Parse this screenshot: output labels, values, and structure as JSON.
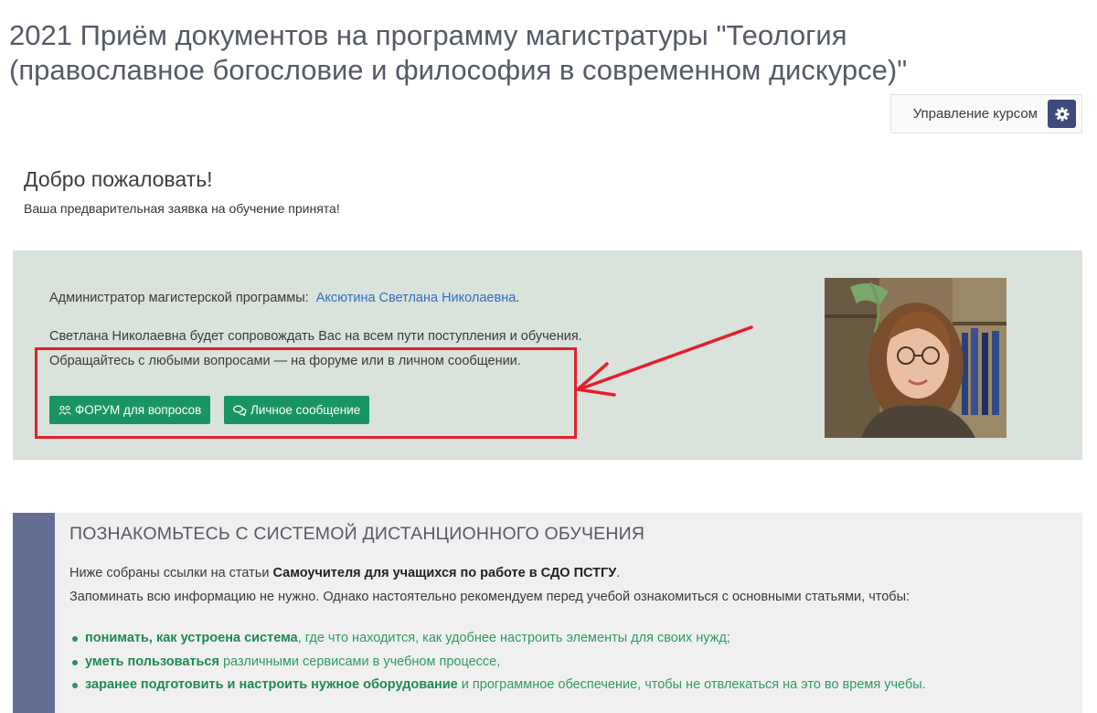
{
  "page": {
    "title": "2021 Приём документов на программу магистратуры \"Теология (православное богословие и философия в современном дискурсе)\""
  },
  "course_admin": {
    "label": "Управление курсом",
    "icon": "gear-icon"
  },
  "welcome": {
    "title": "Добро пожаловать!",
    "text": "Ваша предварительная заявка на обучение принята!"
  },
  "admin_panel": {
    "admin_prefix": "Администратор магистерской программы:",
    "admin_name": "Аксютина Светлана Николаевна",
    "admin_suffix": ".",
    "line2": "Светлана Николаевна будет сопровождать Вас на всем пути поступления и обучения.",
    "line3": "Обращайтесь с любыми вопросами — на форуме или в личном сообщении.",
    "forum_button": "ФОРУМ для вопросов",
    "message_button": "Личное сообщение"
  },
  "info_panel": {
    "title": "ПОЗНАКОМЬТЕСЬ С СИСТЕМОЙ ДИСТАНЦИОННОГО ОБУЧЕНИЯ",
    "line1_prefix": "Ниже собраны ссылки на статьи",
    "line1_bold": "Самоучителя для учащихся по работе в СДО ПСТГУ",
    "line1_suffix": ".",
    "line2": "Запоминать всю информацию не нужно. Однако настоятельно рекомендуем перед учебой ознакомиться с основными статьями, чтобы:",
    "bullets": [
      {
        "bold": "понимать, как устроена система",
        "rest": ", где что находится, как удобнее настроить элементы для своих нужд;"
      },
      {
        "bold": "уметь пользоваться",
        "rest": " различными сервисами в учебном процессе,"
      },
      {
        "bold": "заранее подготовить и настроить нужное оборудование",
        "rest": " и программное обеспечение, чтобы не отвлекаться на это во время учебы."
      }
    ]
  },
  "colors": {
    "accent_green": "#1b9463",
    "highlight_red": "#e3202a",
    "sidebar_bar": "#646e94",
    "gear_button": "#3d4a7a"
  }
}
